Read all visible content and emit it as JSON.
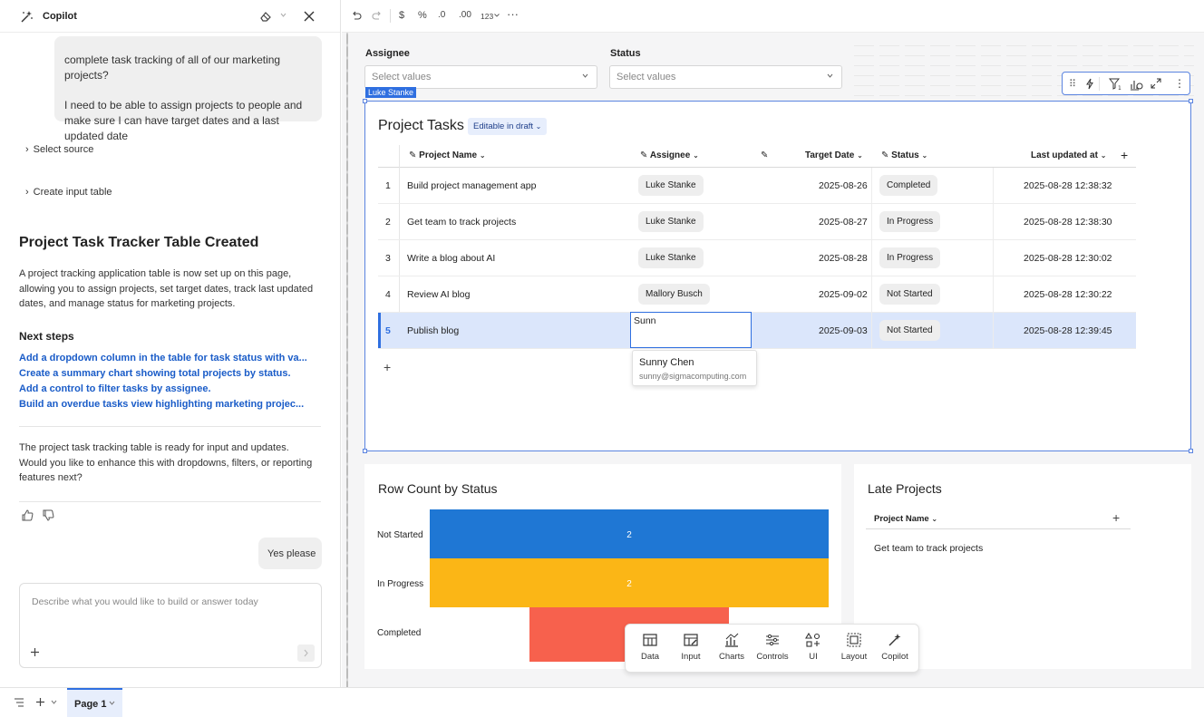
{
  "copilot": {
    "title": "Copilot",
    "user_message_partial_1": "complete task tracking of all of our marketing projects?",
    "user_message_partial_2": "I need to be able to assign projects to people and make sure I can have target dates and a last updated date",
    "steps": [
      "Select source",
      "Create input table"
    ],
    "result_heading": "Project Task Tracker Table Created",
    "result_body": "A project tracking application table is now set up on this page, allowing you to assign projects, set target dates, track last updated dates, and manage status for marketing projects.",
    "next_steps_heading": "Next steps",
    "next_steps": [
      "Add a dropdown column in the table for task status with va...",
      "Create a summary chart showing total projects by status.",
      "Add a control to filter tasks by assignee.",
      "Build an overdue tasks view highlighting marketing projec..."
    ],
    "followup": "The project task tracking table is ready for input and updates. Would you like to enhance this with dropdowns, filters, or reporting features next?",
    "user_reply": "Yes please",
    "input_placeholder": "Describe what you would like to build or answer today"
  },
  "toolbar": {
    "currency": "$",
    "percent": "%",
    "decimal_dec": ".0",
    "decimal_inc": ".00",
    "number_format": "123"
  },
  "controls": {
    "assignee_label": "Assignee",
    "assignee_placeholder": "Select values",
    "status_label": "Status",
    "status_placeholder": "Select values",
    "presence_tag": "Luke Stanke"
  },
  "project_tasks": {
    "title": "Project Tasks",
    "badge": "Editable in draft",
    "columns": [
      "Project Name",
      "Assignee",
      "Target Date",
      "Status",
      "Last updated at"
    ],
    "rows": [
      {
        "n": "1",
        "name": "Build project management app",
        "assignee": "Luke Stanke",
        "target": "2025-08-26",
        "status": "Completed",
        "updated": "2025-08-28 12:38:32"
      },
      {
        "n": "2",
        "name": "Get team to track projects",
        "assignee": "Luke Stanke",
        "target": "2025-08-27",
        "status": "In Progress",
        "updated": "2025-08-28 12:38:30"
      },
      {
        "n": "3",
        "name": "Write a blog about AI",
        "assignee": "Luke Stanke",
        "target": "2025-08-28",
        "status": "In Progress",
        "updated": "2025-08-28 12:30:02"
      },
      {
        "n": "4",
        "name": "Review AI blog",
        "assignee": "Mallory Busch",
        "target": "2025-09-02",
        "status": "Not Started",
        "updated": "2025-08-28 12:30:22"
      },
      {
        "n": "5",
        "name": "Publish blog",
        "assignee": "Sunn",
        "target": "2025-09-03",
        "status": "Not Started",
        "updated": "2025-08-28 12:39:45"
      }
    ],
    "editing_value": "Sunn",
    "suggestion_name": "Sunny Chen",
    "suggestion_email": "sunny@sigmacomputing.com"
  },
  "row_count_chart": {
    "title": "Row Count by Status"
  },
  "chart_data": {
    "type": "bar",
    "orientation": "horizontal-funnel",
    "title": "Row Count by Status",
    "categories": [
      "Not Started",
      "In Progress",
      "Completed"
    ],
    "values": [
      2,
      2,
      1
    ],
    "data_labels": [
      "2",
      "2",
      ""
    ],
    "colors": [
      "#1f77d4",
      "#fbb616",
      "#f7614d"
    ],
    "xlim": [
      0,
      2
    ]
  },
  "late_projects": {
    "title": "Late Projects",
    "column": "Project Name",
    "rows": [
      "Get team to track projects"
    ]
  },
  "insert_bar": {
    "items": [
      "Data",
      "Input",
      "Charts",
      "Controls",
      "UI",
      "Layout",
      "Copilot"
    ]
  },
  "page_tabs": {
    "current": "Page 1"
  },
  "colors": {
    "accent": "#1a5cc8",
    "selection": "#5b84e0",
    "selected_row": "#dbe6fb"
  }
}
